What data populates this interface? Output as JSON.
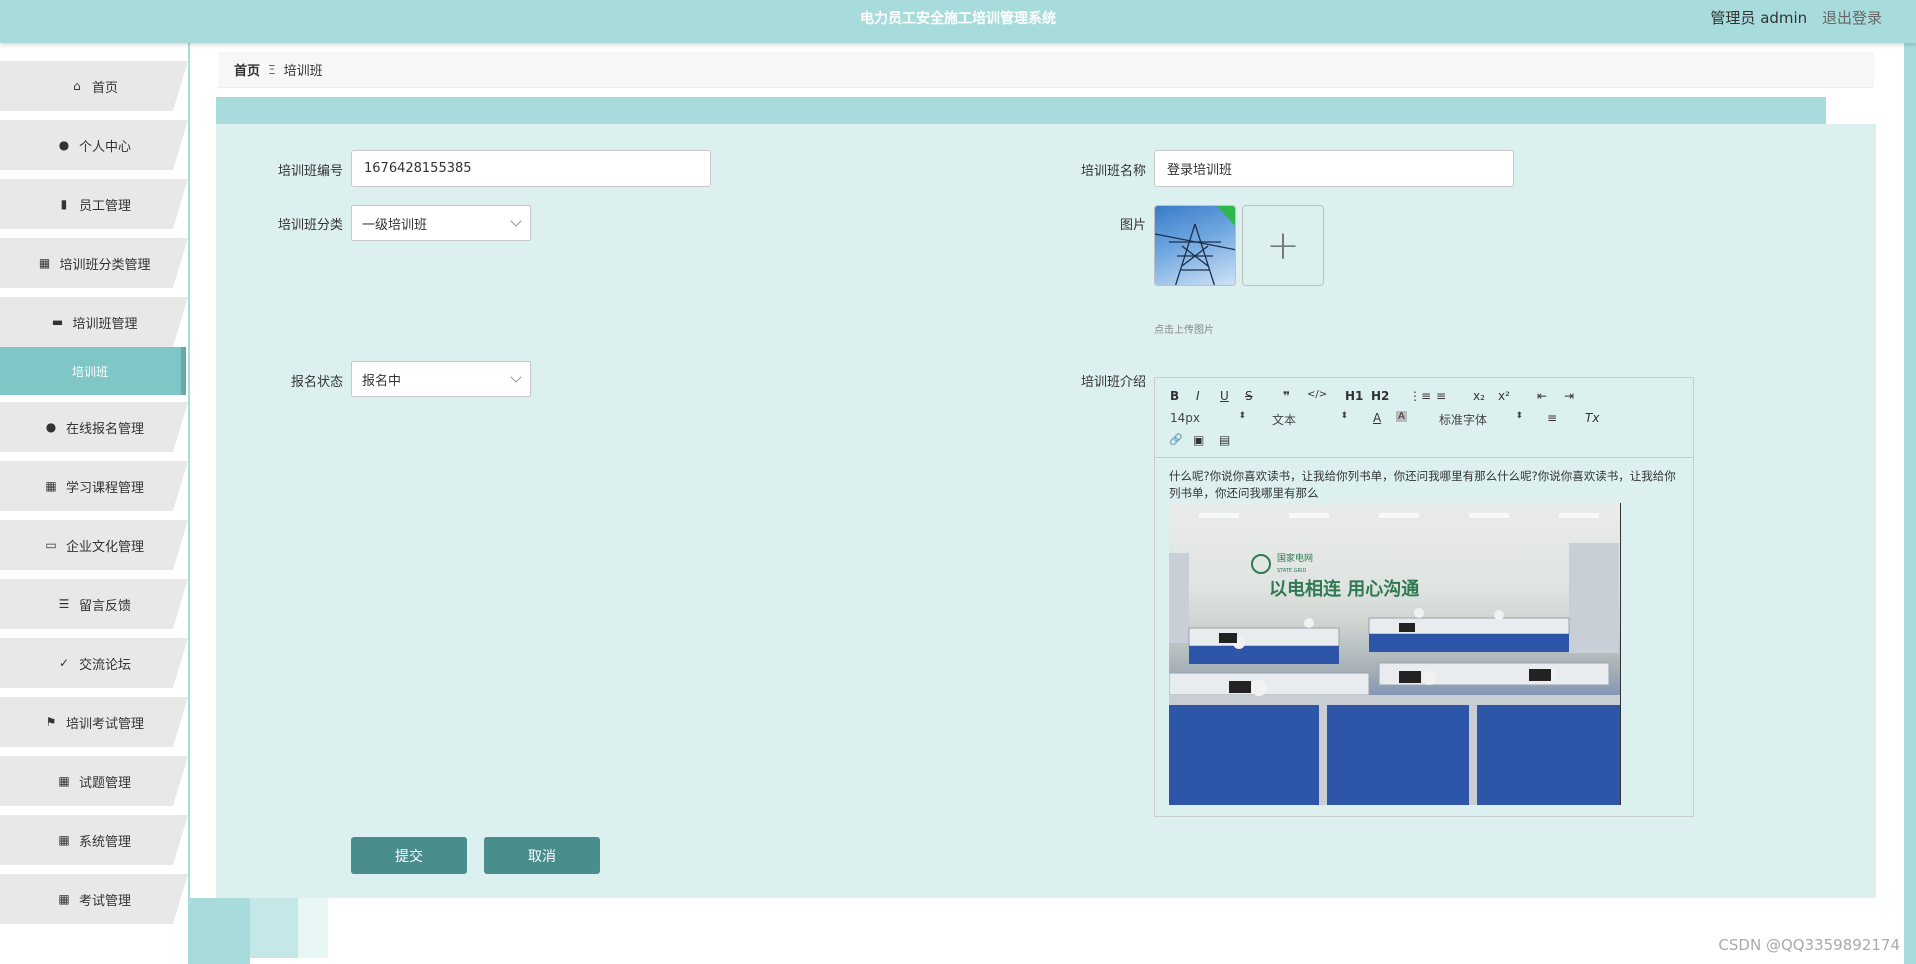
{
  "header": {
    "title": "电力员工安全施工培训管理系统",
    "user_label": "管理员 admin",
    "logout_label": "退出登录"
  },
  "sidebar": {
    "items": [
      {
        "label": "首页",
        "icon": "home-icon"
      },
      {
        "label": "个人中心",
        "icon": "user-icon"
      },
      {
        "label": "员工管理",
        "icon": "bar-chart-icon"
      },
      {
        "label": "培训班分类管理",
        "icon": "grid-icon"
      },
      {
        "label": "培训班管理",
        "icon": "comment-icon"
      },
      {
        "label": "培训班",
        "icon": ""
      },
      {
        "label": "在线报名管理",
        "icon": "user-icon"
      },
      {
        "label": "学习课程管理",
        "icon": "grid-icon"
      },
      {
        "label": "企业文化管理",
        "icon": "monitor-icon"
      },
      {
        "label": "留言反馈",
        "icon": "list-icon"
      },
      {
        "label": "交流论坛",
        "icon": "clipboard-icon"
      },
      {
        "label": "培训考试管理",
        "icon": "flag-icon"
      },
      {
        "label": "试题管理",
        "icon": "grid-icon"
      },
      {
        "label": "系统管理",
        "icon": "grid-icon"
      },
      {
        "label": "考试管理",
        "icon": "grid-icon"
      }
    ]
  },
  "breadcrumb": {
    "home": "首页",
    "separator": "Ξ",
    "current": "培训班"
  },
  "form": {
    "code_label": "培训班编号",
    "code_value": "1676428155385",
    "name_label": "培训班名称",
    "name_value": "登录培训班",
    "category_label": "培训班分类",
    "category_value": "一级培训班",
    "image_label": "图片",
    "upload_hint": "点击上传图片",
    "upload_plus": "+",
    "status_label": "报名状态",
    "status_value": "报名中",
    "intro_label": "培训班介绍",
    "intro_text": "什么呢?你说你喜欢读书，让我给你列书单，你还问我哪里有那么什么呢?你说你喜欢读书，让我给你列书单，你还问我哪里有那么",
    "photo_banner": "以电相连  用心沟通",
    "photo_logo": "国家电网",
    "photo_logo_en": "STATE GRID"
  },
  "editor_toolbar": {
    "bold": "B",
    "italic": "I",
    "underline": "U",
    "strike": "S",
    "quote": "❞",
    "code": "</>",
    "h1": "H1",
    "h2": "H2",
    "ol": "⋮≡",
    "ul": "≡",
    "sub": "x₂",
    "sup": "x²",
    "outdent": "⇤",
    "indent": "⇥",
    "size": "14px",
    "header": "文本",
    "color": "A",
    "bg": "A",
    "font": "标准字体",
    "align": "≡",
    "clean": "Tx",
    "link": "🔗",
    "image": "▣",
    "video": "▤"
  },
  "buttons": {
    "submit": "提交",
    "cancel": "取消"
  },
  "watermark": "CSDN @QQ3359892174",
  "colors": {
    "header_bg": "#a8dcdc",
    "panel_bg": "#dcf0f0",
    "button_bg": "#4a8d8d",
    "active_menu": "#7fc6c6"
  }
}
